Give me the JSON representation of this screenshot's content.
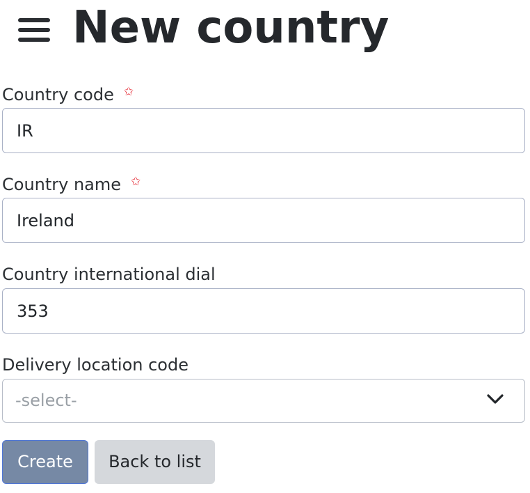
{
  "header": {
    "title": "New country"
  },
  "form": {
    "country_code": {
      "label": "Country code",
      "required_marker": "✩",
      "value": "IR"
    },
    "country_name": {
      "label": "Country name",
      "required_marker": "✩",
      "value": "Ireland"
    },
    "dial": {
      "label": "Country international dial",
      "value": "353"
    },
    "delivery_location": {
      "label": "Delivery location code",
      "selected": "-select-"
    }
  },
  "actions": {
    "create_label": "Create",
    "back_label": "Back to list"
  },
  "icons": {
    "menu": "hamburger-menu-icon",
    "required": "star-outline-icon",
    "dropdown": "chevron-down-icon"
  },
  "colors": {
    "required": "#e8404a",
    "primary_button": "#7689a5",
    "secondary_button": "#d5d8dc",
    "input_border": "#a9b1c6"
  }
}
